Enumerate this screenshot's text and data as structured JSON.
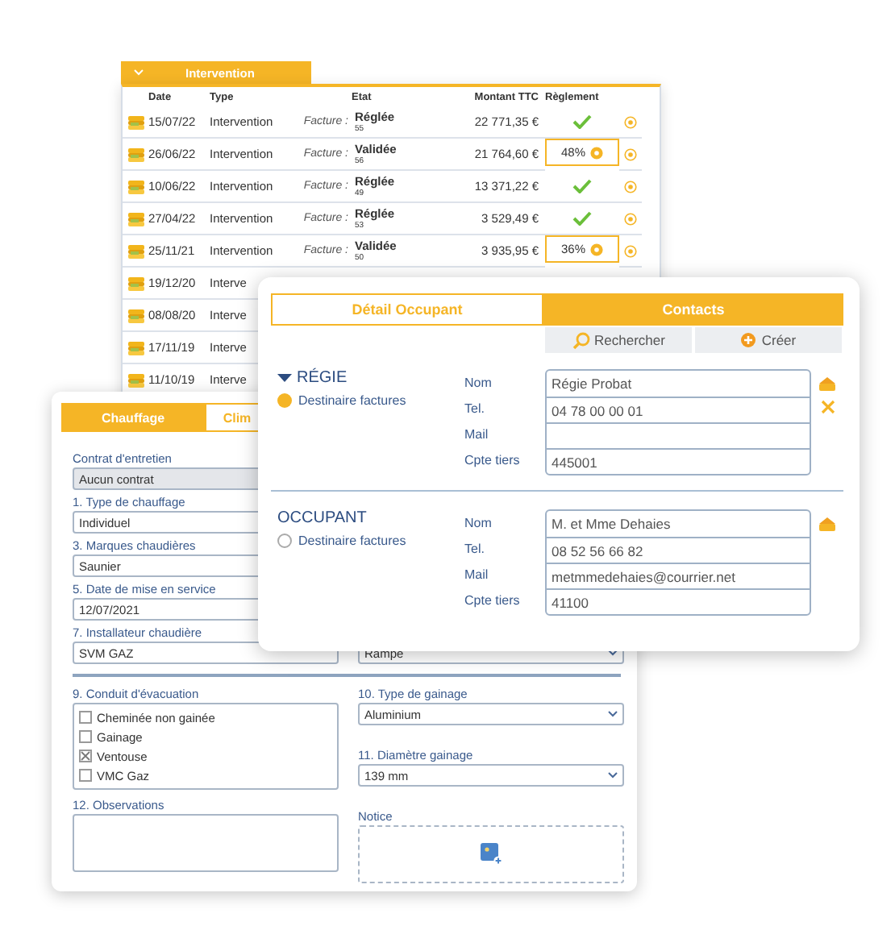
{
  "invoices": {
    "tab": {
      "label": "Intervention"
    },
    "columns": [
      "Date",
      "Type",
      "Etat",
      "Montant TTC",
      "Règlement"
    ],
    "rows": [
      {
        "date": "15/07/22",
        "type": "Intervention",
        "doc_label": "Facture :",
        "status": "Réglée",
        "number": "55",
        "amount": "22 771,35 €",
        "payment": {
          "kind": "paid"
        }
      },
      {
        "date": "26/06/22",
        "type": "Intervention",
        "doc_label": "Facture :",
        "status": "Validée",
        "number": "56",
        "amount": "21 764,60 €",
        "payment": {
          "kind": "partial",
          "percent": "48%"
        }
      },
      {
        "date": "10/06/22",
        "type": "Intervention",
        "doc_label": "Facture :",
        "status": "Réglée",
        "number": "49",
        "amount": "13 371,22 €",
        "payment": {
          "kind": "paid"
        }
      },
      {
        "date": "27/04/22",
        "type": "Intervention",
        "doc_label": "Facture :",
        "status": "Réglée",
        "number": "53",
        "amount": "3 529,49 €",
        "payment": {
          "kind": "paid"
        }
      },
      {
        "date": "25/11/21",
        "type": "Intervention",
        "doc_label": "Facture :",
        "status": "Validée",
        "number": "50",
        "amount": "3 935,95 €",
        "payment": {
          "kind": "partial",
          "percent": "36%"
        }
      },
      {
        "date": "19/12/20",
        "type": "Interve"
      },
      {
        "date": "08/08/20",
        "type": "Interve"
      },
      {
        "date": "17/11/19",
        "type": "Interve"
      },
      {
        "date": "11/10/19",
        "type": "Interve"
      }
    ]
  },
  "heating": {
    "tabs": [
      {
        "label": "Chauffage",
        "selected": true
      },
      {
        "label": "Clim",
        "selected": false
      }
    ],
    "fields": [
      {
        "label": "Contrat  d'entretien",
        "value": "Aucun contrat",
        "kind": "locked"
      },
      {
        "label": "1. Type de chauffage",
        "value": "Individuel",
        "kind": "text"
      },
      {
        "label": "3. Marques chaudières",
        "value": "Saunier",
        "kind": "text"
      },
      {
        "label": "5. Date de mise en service",
        "value": "12/07/2021",
        "kind": "text"
      },
      {
        "label": "7. Installateur chaudière",
        "value": "SVM GAZ",
        "kind": "text"
      }
    ],
    "side_field": {
      "value": "Rampe",
      "kind": "select"
    },
    "exhaust": {
      "label": "9. Conduit d'évacuation",
      "options": [
        {
          "label": "Cheminée non gainée",
          "checked": false
        },
        {
          "label": "Gainage",
          "checked": false
        },
        {
          "label": "Ventouse",
          "checked": true
        },
        {
          "label": "VMC Gaz",
          "checked": false
        }
      ]
    },
    "sheath_type": {
      "label": "10. Type de gainage",
      "value": "Aluminium",
      "kind": "select"
    },
    "sheath_diameter": {
      "label": "11. Diamètre gainage",
      "value": "139 mm",
      "kind": "select"
    },
    "observations": {
      "label": "12. Observations"
    },
    "notice": {
      "label": "Notice"
    }
  },
  "contacts": {
    "tabs": [
      {
        "label": "Détail Occupant",
        "selected": false
      },
      {
        "label": "Contacts",
        "selected": true
      }
    ],
    "actions": [
      {
        "label": "Rechercher",
        "kind": "search"
      },
      {
        "label": "Créer",
        "kind": "add"
      }
    ],
    "sections": [
      {
        "title": "RÉGIE",
        "expanded": true,
        "billing_label": "Destinaire factures",
        "billing": true,
        "fields": [
          {
            "label": "Nom",
            "value": "Régie Probat"
          },
          {
            "label": "Tel.",
            "value": "04 78 00 00 01"
          },
          {
            "label": "Mail"
          },
          {
            "label": "Cpte tiers",
            "value": "445001"
          }
        ],
        "tools": [
          {
            "kind": "edit"
          },
          {
            "kind": "delete"
          }
        ]
      },
      {
        "title": "OCCUPANT",
        "billing_label": "Destinaire factures",
        "billing": false,
        "fields": [
          {
            "label": "Nom",
            "value": "M. et Mme Dehaies"
          },
          {
            "label": "Tel.",
            "value": "08 52 56 66 82"
          },
          {
            "label": "Mail",
            "value": "metmmedehaies@courrier.net"
          },
          {
            "label": "Cpte tiers",
            "value": "41100"
          }
        ],
        "tools": [
          {
            "kind": "edit"
          }
        ]
      }
    ]
  }
}
